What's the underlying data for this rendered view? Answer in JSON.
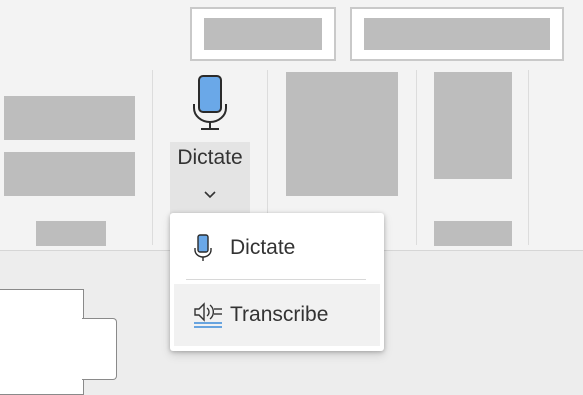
{
  "ribbon": {
    "dictate_button": {
      "label": "Dictate",
      "icon": "microphone-icon",
      "accent": "#6aa8e8"
    }
  },
  "dictate_menu": {
    "items": [
      {
        "label": "Dictate",
        "icon": "microphone-icon"
      },
      {
        "label": "Transcribe",
        "icon": "transcribe-icon"
      }
    ],
    "highlighted_item": "Transcribe"
  },
  "colors": {
    "mic_fill": "#6aa8e8",
    "mic_stroke": "#2b2b2b",
    "transcribe_accent": "#3b8ad9"
  }
}
